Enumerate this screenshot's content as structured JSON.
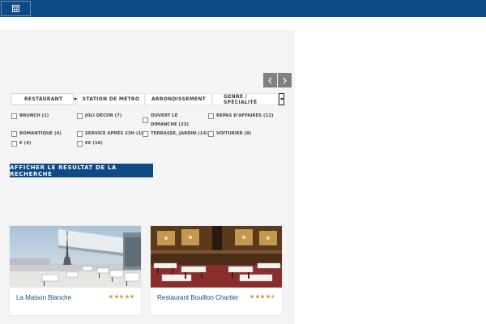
{
  "topbar": {
    "button_icon": "calendar-icon"
  },
  "pager": {
    "prev_icon": "chevron-left-icon",
    "next_icon": "chevron-right-icon"
  },
  "tabs": {
    "selected": "RESTAURANT",
    "items": [
      "STATION DE MÉTRO",
      "ARRONDISSEMENT",
      "GENRE / SPÉCIALITÉ"
    ]
  },
  "filters": [
    {
      "label": "BRUNCH (1)",
      "checked": false
    },
    {
      "label": "JOLI DÉCOR (7)",
      "checked": false
    },
    {
      "label": "OUVERT LE DIMANCHE (23)",
      "checked": false
    },
    {
      "label": "REPAS D'AFFAIRES (12)",
      "checked": false
    },
    {
      "label": "ROMANTIQUE (4)",
      "checked": false
    },
    {
      "label": "SERVICE APRÈS 23H (10)",
      "checked": false
    },
    {
      "label": "TERRASSE, JARDIN (14)",
      "checked": false
    },
    {
      "label": "VOITURIER (9)",
      "checked": false
    },
    {
      "label": "€ (4)",
      "checked": false
    },
    {
      "label": "€€ (16)",
      "checked": false
    }
  ],
  "search_button": "AFFICHER LE RÉSULTAT DE LA RECHERCHE",
  "cards": [
    {
      "name": "La Maison Blanche",
      "rating": 5,
      "rating_max": 5
    },
    {
      "name": "Restaurant Bouillon Chartier",
      "rating": 4.5,
      "rating_max": 5
    }
  ],
  "colors": {
    "brand": "#0d4a86",
    "star": "#c9a14a",
    "panel": "#f4f4f4"
  }
}
